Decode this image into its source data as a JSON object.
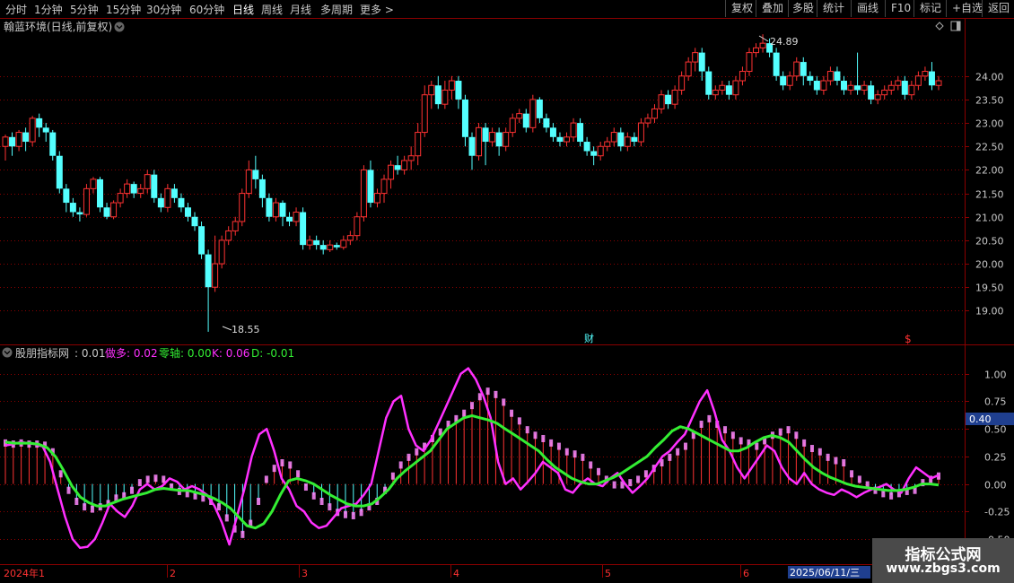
{
  "toolbar": {
    "timeframes": [
      "分时",
      "1分钟",
      "5分钟",
      "15分钟",
      "30分钟",
      "60分钟",
      "日线",
      "周线",
      "月线",
      "多周期",
      "更多 >"
    ],
    "active": "日线",
    "right_buttons": [
      "复权",
      "叠加",
      "多股",
      "统计",
      "画线",
      "F10",
      "标记",
      "+自选",
      "返回"
    ]
  },
  "main_chart": {
    "title": "翰蓝环境(日线,前复权)",
    "high_label": "24.89",
    "low_label": "18.55",
    "price_ticks": [
      "24.00",
      "23.50",
      "23.00",
      "22.50",
      "22.00",
      "21.50",
      "21.00",
      "20.50",
      "20.00",
      "19.50",
      "19.00"
    ],
    "marker_cai": "财",
    "marker_s": "$"
  },
  "indicator": {
    "name": "股朋指标网",
    "value": ": 0.01",
    "zuoduo_label": "做多: 0.02",
    "zero_label": "零轴: 0.00",
    "k_label": "K: 0.06",
    "d_label": "D: -0.01",
    "y_ticks": [
      "1.00",
      "0.75",
      "0.50",
      "0.25",
      "0.00",
      "-0.25",
      "-0.50"
    ],
    "level_label": "0.40"
  },
  "date_axis": {
    "labels": [
      "2024年1",
      "2",
      "3",
      "4",
      "5",
      "6"
    ],
    "current_date": "2025/06/11/三"
  },
  "watermark": {
    "line1": "指标公式网",
    "line2": "www.zbgs3.com"
  },
  "colors": {
    "up": "#ff3232",
    "down": "#54ffff",
    "k_line": "#ff30ff",
    "d_line": "#33ee33",
    "grid": "#8b0000"
  },
  "chart_data": {
    "type": "candlestick",
    "title": "翰蓝环境(日线,前复权)",
    "ylim": [
      18.3,
      25.2
    ],
    "candles": [
      [
        22.5,
        22.7,
        22.2,
        22.75
      ],
      [
        22.7,
        22.5,
        22.3,
        22.8
      ],
      [
        22.5,
        22.8,
        22.4,
        22.85
      ],
      [
        22.8,
        22.6,
        22.4,
        22.9
      ],
      [
        22.6,
        23.1,
        22.5,
        23.15
      ],
      [
        23.1,
        22.9,
        22.7,
        23.2
      ],
      [
        22.9,
        22.8,
        22.6,
        23.0
      ],
      [
        22.8,
        22.3,
        22.2,
        22.85
      ],
      [
        22.3,
        21.6,
        21.5,
        22.4
      ],
      [
        21.6,
        21.3,
        21.1,
        21.7
      ],
      [
        21.3,
        21.1,
        21.0,
        21.4
      ],
      [
        21.1,
        21.05,
        20.9,
        21.2
      ],
      [
        21.05,
        21.6,
        21.0,
        21.7
      ],
      [
        21.6,
        21.8,
        21.5,
        21.85
      ],
      [
        21.8,
        21.2,
        21.1,
        21.85
      ],
      [
        21.2,
        21.0,
        20.95,
        21.3
      ],
      [
        21.0,
        21.3,
        20.95,
        21.35
      ],
      [
        21.3,
        21.5,
        21.2,
        21.6
      ],
      [
        21.5,
        21.7,
        21.4,
        21.8
      ],
      [
        21.7,
        21.5,
        21.4,
        21.75
      ],
      [
        21.5,
        21.6,
        21.4,
        21.7
      ],
      [
        21.6,
        21.9,
        21.5,
        22.0
      ],
      [
        21.9,
        21.4,
        21.3,
        22.0
      ],
      [
        21.4,
        21.2,
        21.1,
        21.5
      ],
      [
        21.2,
        21.6,
        21.1,
        21.7
      ],
      [
        21.6,
        21.4,
        21.3,
        21.7
      ],
      [
        21.4,
        21.2,
        21.1,
        21.5
      ],
      [
        21.2,
        21.0,
        20.9,
        21.3
      ],
      [
        21.0,
        20.8,
        20.7,
        21.1
      ],
      [
        20.8,
        20.2,
        20.1,
        20.9
      ],
      [
        20.2,
        19.5,
        18.55,
        20.3
      ],
      [
        19.5,
        20.0,
        19.4,
        20.6
      ],
      [
        20.0,
        20.5,
        19.9,
        20.6
      ],
      [
        20.5,
        20.7,
        20.4,
        20.8
      ],
      [
        20.7,
        20.9,
        20.6,
        21.0
      ],
      [
        20.9,
        21.5,
        20.8,
        21.6
      ],
      [
        21.5,
        22.0,
        21.4,
        22.2
      ],
      [
        22.0,
        21.8,
        21.6,
        22.3
      ],
      [
        21.8,
        21.4,
        21.2,
        21.9
      ],
      [
        21.4,
        21.0,
        20.9,
        21.5
      ],
      [
        21.0,
        21.3,
        20.9,
        21.4
      ],
      [
        21.3,
        21.0,
        20.8,
        21.35
      ],
      [
        21.0,
        20.9,
        20.8,
        21.1
      ],
      [
        20.9,
        21.1,
        20.8,
        21.2
      ],
      [
        21.1,
        20.4,
        20.3,
        21.2
      ],
      [
        20.4,
        20.5,
        20.3,
        20.6
      ],
      [
        20.5,
        20.4,
        20.3,
        20.6
      ],
      [
        20.4,
        20.3,
        20.2,
        20.5
      ],
      [
        20.3,
        20.4,
        20.25,
        20.5
      ],
      [
        20.4,
        20.35,
        20.3,
        20.45
      ],
      [
        20.35,
        20.5,
        20.3,
        20.6
      ],
      [
        20.5,
        20.6,
        20.4,
        20.7
      ],
      [
        20.6,
        21.0,
        20.5,
        21.1
      ],
      [
        21.0,
        22.0,
        20.9,
        22.1
      ],
      [
        22.0,
        21.3,
        21.2,
        22.2
      ],
      [
        21.3,
        21.5,
        21.2,
        21.6
      ],
      [
        21.5,
        21.8,
        21.3,
        21.9
      ],
      [
        21.8,
        22.1,
        21.6,
        22.2
      ],
      [
        22.1,
        22.0,
        21.9,
        22.3
      ],
      [
        22.0,
        22.2,
        21.9,
        22.3
      ],
      [
        22.2,
        22.3,
        22.0,
        22.5
      ],
      [
        22.3,
        22.8,
        22.1,
        23.0
      ],
      [
        22.8,
        23.6,
        22.7,
        23.8
      ],
      [
        23.6,
        23.8,
        23.3,
        23.9
      ],
      [
        23.8,
        23.4,
        23.3,
        24.0
      ],
      [
        23.4,
        23.7,
        23.3,
        23.9
      ],
      [
        23.7,
        23.9,
        23.5,
        24.0
      ],
      [
        23.9,
        23.5,
        23.3,
        24.0
      ],
      [
        23.5,
        22.7,
        22.5,
        23.6
      ],
      [
        22.7,
        22.3,
        22.0,
        22.8
      ],
      [
        22.3,
        22.9,
        22.2,
        23.0
      ],
      [
        22.9,
        22.6,
        22.1,
        23.0
      ],
      [
        22.6,
        22.8,
        22.5,
        22.9
      ],
      [
        22.8,
        22.5,
        22.3,
        22.9
      ],
      [
        22.5,
        22.8,
        22.4,
        22.9
      ],
      [
        22.8,
        23.1,
        22.7,
        23.2
      ],
      [
        23.1,
        23.2,
        23.0,
        23.3
      ],
      [
        23.2,
        22.9,
        22.8,
        23.3
      ],
      [
        22.9,
        23.5,
        22.8,
        23.6
      ],
      [
        23.5,
        23.1,
        23.0,
        23.55
      ],
      [
        23.1,
        22.9,
        22.8,
        23.2
      ],
      [
        22.9,
        22.7,
        22.6,
        23.0
      ],
      [
        22.7,
        22.6,
        22.5,
        22.8
      ],
      [
        22.6,
        22.7,
        22.5,
        22.8
      ],
      [
        22.7,
        23.0,
        22.6,
        23.1
      ],
      [
        23.0,
        22.6,
        22.5,
        23.1
      ],
      [
        22.6,
        22.4,
        22.3,
        22.7
      ],
      [
        22.4,
        22.3,
        22.1,
        22.5
      ],
      [
        22.3,
        22.5,
        22.2,
        22.6
      ],
      [
        22.5,
        22.6,
        22.4,
        22.7
      ],
      [
        22.6,
        22.8,
        22.5,
        22.9
      ],
      [
        22.8,
        22.5,
        22.4,
        22.9
      ],
      [
        22.5,
        22.7,
        22.4,
        22.8
      ],
      [
        22.7,
        22.6,
        22.5,
        22.8
      ],
      [
        22.6,
        23.0,
        22.5,
        23.1
      ],
      [
        23.0,
        23.1,
        22.9,
        23.2
      ],
      [
        23.1,
        23.3,
        23.0,
        23.4
      ],
      [
        23.3,
        23.6,
        23.2,
        23.7
      ],
      [
        23.6,
        23.4,
        23.3,
        23.7
      ],
      [
        23.4,
        23.7,
        23.3,
        23.8
      ],
      [
        23.7,
        24.0,
        23.6,
        24.1
      ],
      [
        24.0,
        24.3,
        23.9,
        24.4
      ],
      [
        24.3,
        24.5,
        24.1,
        24.6
      ],
      [
        24.5,
        24.1,
        23.9,
        24.6
      ],
      [
        24.1,
        23.6,
        23.5,
        24.2
      ],
      [
        23.6,
        23.7,
        23.5,
        23.8
      ],
      [
        23.7,
        23.8,
        23.6,
        23.9
      ],
      [
        23.8,
        23.6,
        23.5,
        23.9
      ],
      [
        23.6,
        23.9,
        23.5,
        24.0
      ],
      [
        23.9,
        24.1,
        23.8,
        24.2
      ],
      [
        24.1,
        24.5,
        24.0,
        24.6
      ],
      [
        24.5,
        24.6,
        24.4,
        24.7
      ],
      [
        24.6,
        24.7,
        24.5,
        24.89
      ],
      [
        24.7,
        24.5,
        24.4,
        24.8
      ],
      [
        24.5,
        24.0,
        23.9,
        24.6
      ],
      [
        24.0,
        23.8,
        23.7,
        24.1
      ],
      [
        23.8,
        24.0,
        23.7,
        24.1
      ],
      [
        24.0,
        24.3,
        23.9,
        24.4
      ],
      [
        24.3,
        24.0,
        23.8,
        24.4
      ],
      [
        24.0,
        23.9,
        23.8,
        24.1
      ],
      [
        23.9,
        23.7,
        23.6,
        24.0
      ],
      [
        23.7,
        23.9,
        23.6,
        24.0
      ],
      [
        23.9,
        24.1,
        23.8,
        24.2
      ],
      [
        24.1,
        23.9,
        23.8,
        24.2
      ],
      [
        23.9,
        23.7,
        23.6,
        24.0
      ],
      [
        23.7,
        23.8,
        23.6,
        23.9
      ],
      [
        23.8,
        23.7,
        23.6,
        24.5
      ],
      [
        23.7,
        23.8,
        23.6,
        23.9
      ],
      [
        23.8,
        23.5,
        23.4,
        23.9
      ],
      [
        23.5,
        23.6,
        23.4,
        23.7
      ],
      [
        23.6,
        23.7,
        23.5,
        23.8
      ],
      [
        23.7,
        23.8,
        23.6,
        23.9
      ],
      [
        23.8,
        23.9,
        23.7,
        24.0
      ],
      [
        23.9,
        23.6,
        23.5,
        24.0
      ],
      [
        23.6,
        23.8,
        23.5,
        23.9
      ],
      [
        23.8,
        24.0,
        23.7,
        24.1
      ],
      [
        24.0,
        24.1,
        23.9,
        24.2
      ],
      [
        24.1,
        23.8,
        23.7,
        24.3
      ],
      [
        23.8,
        23.9,
        23.7,
        24.0
      ]
    ],
    "indicator_ylim": [
      -0.72,
      1.12
    ],
    "k_series": [
      0.35,
      0.36,
      0.38,
      0.37,
      0.36,
      0.34,
      0.2,
      -0.05,
      -0.3,
      -0.5,
      -0.58,
      -0.57,
      -0.5,
      -0.35,
      -0.18,
      -0.25,
      -0.3,
      -0.2,
      -0.05,
      0.0,
      -0.05,
      -0.02,
      0.05,
      0.02,
      -0.05,
      -0.02,
      -0.05,
      -0.1,
      -0.2,
      -0.35,
      -0.55,
      -0.3,
      -0.05,
      0.25,
      0.45,
      0.5,
      0.3,
      0.05,
      -0.05,
      -0.2,
      -0.25,
      -0.35,
      -0.4,
      -0.38,
      -0.3,
      -0.22,
      -0.2,
      -0.18,
      -0.1,
      0.0,
      0.3,
      0.6,
      0.75,
      0.8,
      0.5,
      0.35,
      0.3,
      0.4,
      0.55,
      0.7,
      0.85,
      1.0,
      1.05,
      0.95,
      0.8,
      0.6,
      0.2,
      0.0,
      0.05,
      -0.05,
      0.02,
      0.1,
      0.2,
      0.15,
      0.1,
      -0.05,
      -0.08,
      0.0,
      0.05,
      0.0,
      -0.02,
      0.05,
      0.1,
      0.0,
      -0.08,
      -0.02,
      0.05,
      0.15,
      0.25,
      0.3,
      0.38,
      0.45,
      0.6,
      0.75,
      0.85,
      0.65,
      0.4,
      0.3,
      0.15,
      0.05,
      0.15,
      0.25,
      0.35,
      0.3,
      0.15,
      0.05,
      0.0,
      0.1,
      0.0,
      -0.05,
      -0.08,
      -0.1,
      -0.05,
      -0.08,
      -0.12,
      -0.08,
      -0.05,
      -0.03,
      0.0,
      -0.05,
      -0.08,
      0.05,
      0.15,
      0.1,
      0.05,
      0.08
    ],
    "d_series": [
      0.38,
      0.37,
      0.37,
      0.37,
      0.36,
      0.33,
      0.25,
      0.12,
      -0.02,
      -0.12,
      -0.17,
      -0.2,
      -0.2,
      -0.17,
      -0.14,
      -0.12,
      -0.1,
      -0.08,
      -0.05,
      -0.04,
      -0.05,
      -0.06,
      -0.06,
      -0.08,
      -0.1,
      -0.13,
      -0.17,
      -0.22,
      -0.3,
      -0.38,
      -0.4,
      -0.36,
      -0.25,
      -0.1,
      0.03,
      0.05,
      0.03,
      0.0,
      -0.05,
      -0.1,
      -0.14,
      -0.18,
      -0.2,
      -0.2,
      -0.18,
      -0.12,
      -0.05,
      0.05,
      0.12,
      0.18,
      0.24,
      0.3,
      0.4,
      0.5,
      0.55,
      0.6,
      0.62,
      0.6,
      0.58,
      0.55,
      0.5,
      0.45,
      0.4,
      0.35,
      0.3,
      0.22,
      0.15,
      0.1,
      0.05,
      0.02,
      0.0,
      0.0,
      0.03,
      0.06,
      0.1,
      0.15,
      0.2,
      0.25,
      0.33,
      0.4,
      0.48,
      0.52,
      0.5,
      0.46,
      0.42,
      0.38,
      0.34,
      0.3,
      0.3,
      0.33,
      0.38,
      0.42,
      0.44,
      0.42,
      0.38,
      0.3,
      0.22,
      0.15,
      0.1,
      0.06,
      0.03,
      0.0,
      -0.02,
      -0.03,
      -0.04,
      -0.05,
      -0.06,
      -0.06,
      -0.05,
      -0.03,
      0.0,
      0.0,
      -0.01
    ],
    "bar_series": [
      0.38,
      0.37,
      0.38,
      0.37,
      0.37,
      0.36,
      0.3,
      0.1,
      -0.05,
      -0.15,
      -0.2,
      -0.22,
      -0.2,
      -0.17,
      -0.12,
      -0.1,
      -0.05,
      0.02,
      0.05,
      0.06,
      0.05,
      -0.02,
      -0.06,
      -0.08,
      -0.1,
      -0.12,
      -0.15,
      -0.2,
      -0.3,
      -0.4,
      -0.45,
      -0.35,
      -0.15,
      0.05,
      0.15,
      0.2,
      0.18,
      0.1,
      -0.02,
      -0.1,
      -0.15,
      -0.2,
      -0.25,
      -0.27,
      -0.28,
      -0.25,
      -0.2,
      -0.15,
      -0.05,
      0.08,
      0.18,
      0.25,
      0.3,
      0.35,
      0.42,
      0.48,
      0.55,
      0.6,
      0.65,
      0.72,
      0.8,
      0.85,
      0.82,
      0.75,
      0.65,
      0.58,
      0.5,
      0.45,
      0.42,
      0.38,
      0.35,
      0.3,
      0.28,
      0.25,
      0.18,
      0.12,
      0.05,
      0.0,
      0.0,
      0.02,
      0.05,
      0.1,
      0.15,
      0.2,
      0.25,
      0.3,
      0.35,
      0.45,
      0.55,
      0.6,
      0.55,
      0.5,
      0.45,
      0.4,
      0.38,
      0.35,
      0.4,
      0.45,
      0.48,
      0.5,
      0.45,
      0.38,
      0.33,
      0.3,
      0.25,
      0.22,
      0.2,
      0.1,
      0.05,
      0.0,
      -0.05,
      -0.08,
      -0.1,
      -0.08,
      -0.06,
      -0.05,
      0.02,
      0.05,
      0.08
    ]
  }
}
